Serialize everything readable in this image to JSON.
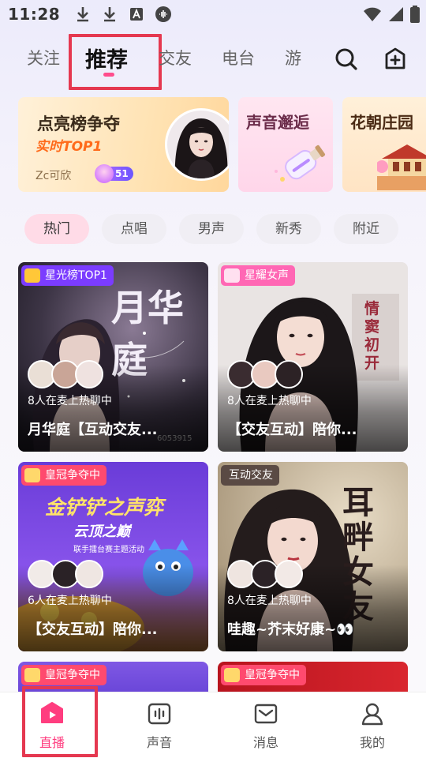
{
  "status_bar": {
    "time": "11:28",
    "icons": [
      "download-icon",
      "download-icon",
      "text-box-icon",
      "podcast-icon"
    ],
    "right_icons": [
      "wifi-icon",
      "signal-icon",
      "battery-icon"
    ]
  },
  "top_tabs": {
    "items": [
      {
        "label": "关注",
        "active": false
      },
      {
        "label": "推荐",
        "active": true
      },
      {
        "label": "交友",
        "active": false
      },
      {
        "label": "电台",
        "active": false
      },
      {
        "label": "游",
        "active": false
      }
    ],
    "search_icon": "search-icon",
    "create_icon": "add-square-icon"
  },
  "banners": {
    "rank": {
      "title": "点亮榜争夺",
      "subtitle": "实时TOP1",
      "user": "Zc可欣",
      "badge_level": "51"
    },
    "voice": {
      "title": "声音邂逅"
    },
    "garden": {
      "title": "花朝庄园"
    }
  },
  "chips": [
    {
      "label": "热门",
      "active": true
    },
    {
      "label": "点唱",
      "active": false
    },
    {
      "label": "男声",
      "active": false
    },
    {
      "label": "新秀",
      "active": false
    },
    {
      "label": "附近",
      "active": false
    }
  ],
  "cards": [
    {
      "tag": "星光榜TOP1",
      "tag_color": "#7b3cff",
      "art_text": "月华庭",
      "watermark": "6053915",
      "listeners": "8人在麦上热聊中",
      "title": "月华庭【互动交友..."
    },
    {
      "tag": "星耀女声",
      "tag_color": "#ff67b4",
      "art_text": "情窦初开",
      "listeners": "8人在麦上热聊中",
      "title": "【交友互动】陪你..."
    },
    {
      "tag": "皇冠争夺中",
      "tag_color": "#ff4a6e",
      "art_text": "金铲铲之声弈",
      "art_sub": "云顶之巅",
      "art_note": "联手擂台赛主题活动",
      "listeners": "6人在麦上热聊中",
      "title": "【交友互动】陪你..."
    },
    {
      "tag": "互动交友",
      "tag_color": "#5a4a44",
      "art_text": "耳畔女友",
      "listeners": "8人在麦上热聊中",
      "title": "哇趣~芥末好康~👀"
    },
    {
      "tag": "皇冠争夺中",
      "tag_color": "#ff4a6e"
    },
    {
      "tag": "皇冠争夺中",
      "tag_color": "#ff4a6e"
    }
  ],
  "bottom_nav": [
    {
      "label": "直播",
      "icon": "live-icon",
      "active": true
    },
    {
      "label": "声音",
      "icon": "audio-wave-icon",
      "active": false
    },
    {
      "label": "消息",
      "icon": "mail-icon",
      "active": false
    },
    {
      "label": "我的",
      "icon": "profile-icon",
      "active": false
    }
  ]
}
